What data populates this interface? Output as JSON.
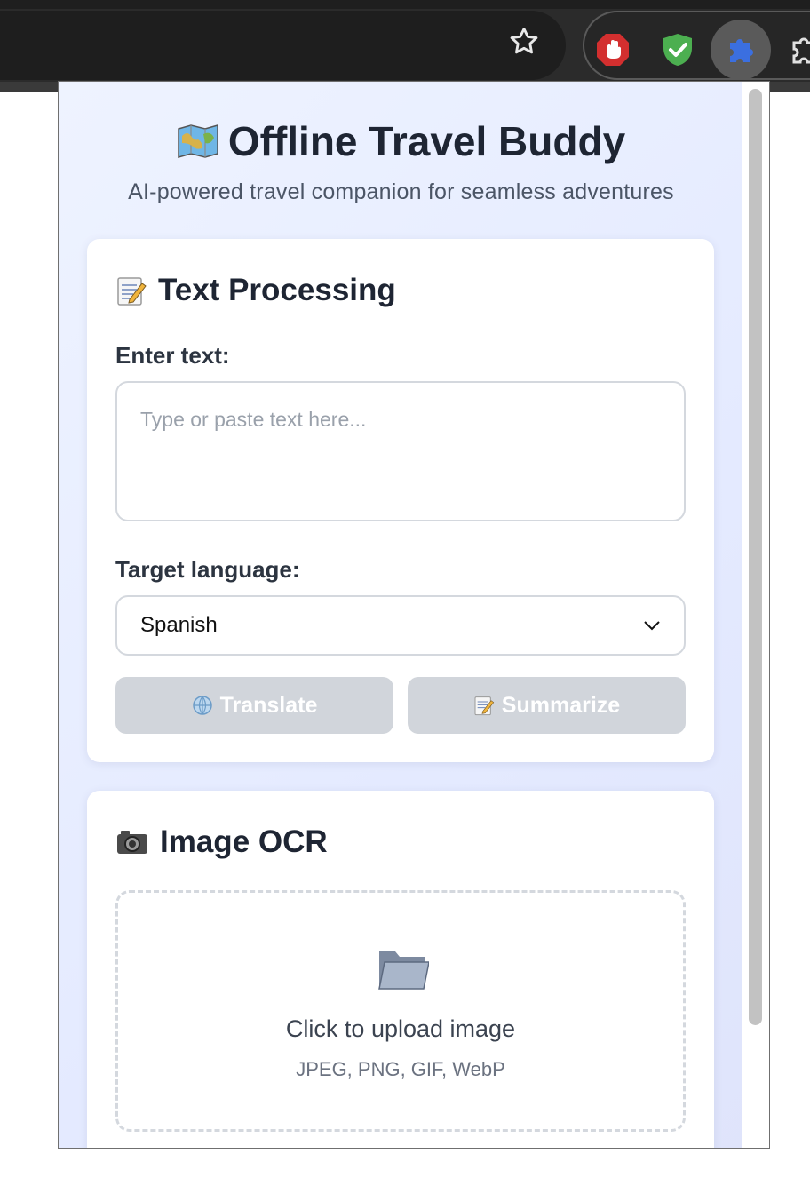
{
  "popup": {
    "title": "Offline Travel Buddy",
    "subtitle": "AI-powered travel companion for seamless adventures",
    "title_icon": "map-emoji"
  },
  "text_processing": {
    "heading": "Text Processing",
    "heading_icon": "memo-emoji",
    "input_label": "Enter text:",
    "input_placeholder": "Type or paste text here...",
    "input_value": "",
    "language_label": "Target language:",
    "language_selected": "Spanish",
    "translate_label": "Translate",
    "summarize_label": "Summarize"
  },
  "image_ocr": {
    "heading": "Image OCR",
    "heading_icon": "camera-emoji",
    "upload_title": "Click to upload image",
    "upload_formats": "JPEG, PNG, GIF, WebP"
  },
  "extensions": [
    "adblock-icon",
    "shield-check-icon",
    "puzzle-extension-icon",
    "extensions-menu-icon"
  ],
  "colors": {
    "title": "#1e2533",
    "button_disabled": "#d1d5db",
    "adblock_red": "#d32f2f",
    "shield_green": "#4caf50",
    "extension_blue": "#3b6fe0"
  }
}
